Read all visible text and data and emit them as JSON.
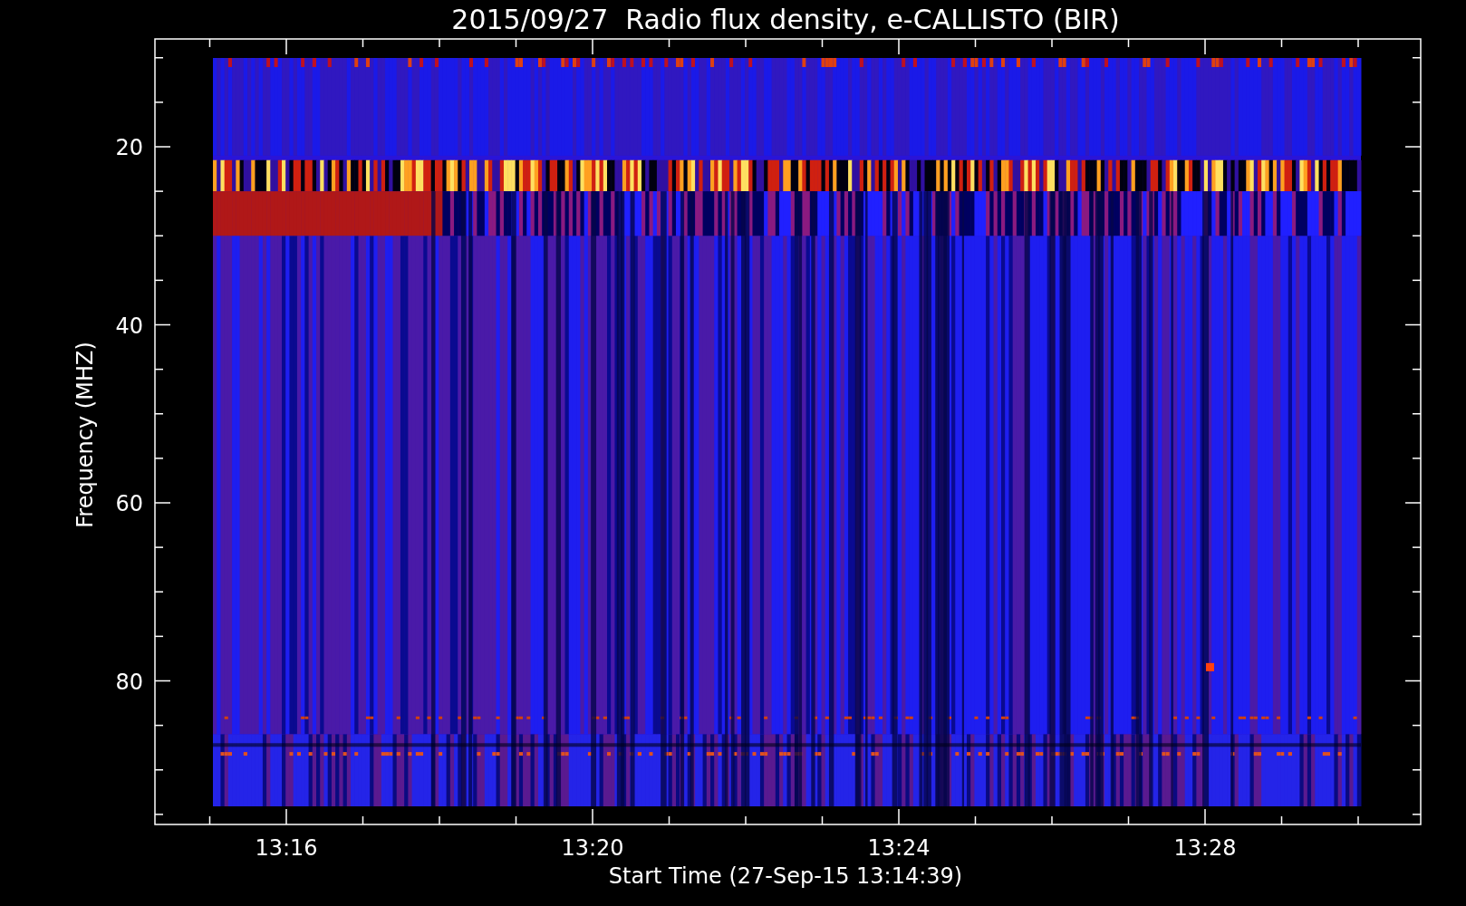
{
  "title": "2015/09/27  Radio flux density, e-CALLISTO (BIR)",
  "y_axis": {
    "label": "Frequency (MHZ)",
    "ticks": [
      "20",
      "40",
      "60",
      "80"
    ]
  },
  "x_axis": {
    "label": "Start Time (27-Sep-15 13:14:39)",
    "ticks": [
      "13:16",
      "13:20",
      "13:24",
      "13:28"
    ]
  }
}
